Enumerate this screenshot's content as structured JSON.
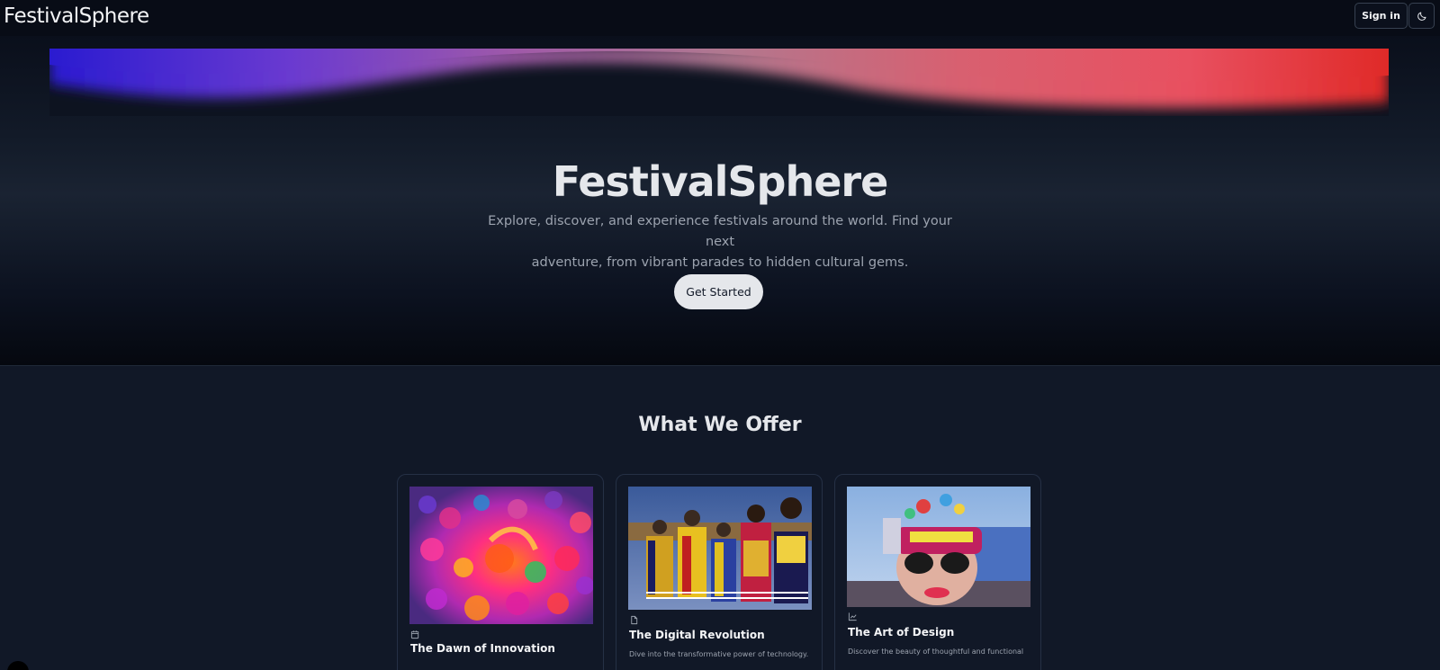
{
  "header": {
    "brand": "FestivalSphere",
    "signin_label": "Sign in",
    "theme_icon": "moon-icon"
  },
  "hero": {
    "title": "FestivalSphere",
    "subtitle_line1": "Explore, discover, and experience festivals around the world. Find your next",
    "subtitle_line2": "adventure, from vibrant parades to hidden cultural gems.",
    "cta_label": "Get Started"
  },
  "offer": {
    "title": "What We Offer",
    "cards": [
      {
        "icon": "calendar-clock-icon",
        "title": "The Dawn of Innovation",
        "description": "",
        "image": "crowd-color-festival-photo"
      },
      {
        "icon": "document-icon",
        "title": "The Digital Revolution",
        "description": "Dive into the transformative power of technology.",
        "image": "traditional-dress-group-photo"
      },
      {
        "icon": "chart-icon",
        "title": "The Art of Design",
        "description": "Discover the beauty of thoughtful and functional",
        "image": "carnival-mask-float-photo"
      }
    ]
  },
  "colors": {
    "background": "#111827",
    "band_left": "#3a1fd0",
    "band_right": "#e03030",
    "cta_bg": "#e5e7eb"
  }
}
